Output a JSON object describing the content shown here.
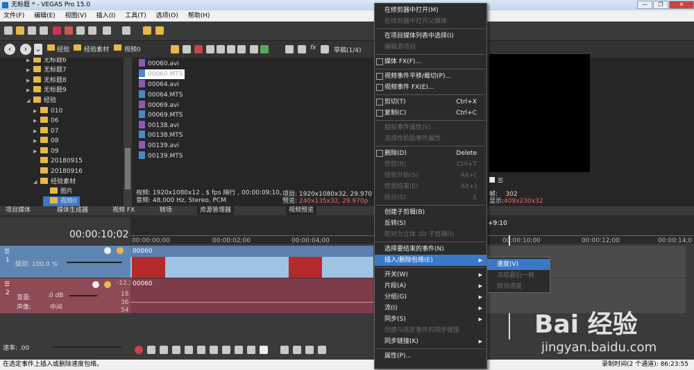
{
  "window": {
    "title": "无标题 * - VEGAS Pro 15.0"
  },
  "menubar": [
    "文件(F)",
    "编辑(E)",
    "视图(V)",
    "插入(I)",
    "工具(T)",
    "选项(O)",
    "帮助(H)"
  ],
  "explorer": {
    "breadcrumb": [
      "经验",
      "经验素材",
      "视频0"
    ],
    "tree": [
      {
        "label": "无标题6",
        "indent": 2
      },
      {
        "label": "无标题7",
        "indent": 2
      },
      {
        "label": "无标题8",
        "indent": 2
      },
      {
        "label": "无标题9",
        "indent": 2
      },
      {
        "label": "经验",
        "indent": 1
      },
      {
        "label": "010",
        "indent": 3
      },
      {
        "label": "06",
        "indent": 3
      },
      {
        "label": "07",
        "indent": 3
      },
      {
        "label": "08",
        "indent": 3
      },
      {
        "label": "09",
        "indent": 3
      },
      {
        "label": "20180915",
        "indent": 3
      },
      {
        "label": "20180916",
        "indent": 3
      },
      {
        "label": "经验素材",
        "indent": 2
      },
      {
        "label": "图片",
        "indent": 3
      },
      {
        "label": "视频0",
        "indent": 3
      }
    ],
    "files": [
      {
        "name": "00060.avi",
        "type": "avi"
      },
      {
        "name": "00060.MTS",
        "type": "mts"
      },
      {
        "name": "00064.avi",
        "type": "avi"
      },
      {
        "name": "00064.MTS",
        "type": "mts"
      },
      {
        "name": "00069.avi",
        "type": "avi"
      },
      {
        "name": "00069.MTS",
        "type": "mts"
      },
      {
        "name": "00138.avi",
        "type": "avi"
      },
      {
        "name": "00138.MTS",
        "type": "mts"
      },
      {
        "name": "00139.avi",
        "type": "avi"
      },
      {
        "name": "00139.MTS",
        "type": "mts"
      }
    ],
    "info_video": "视频: 1920x1080x12 , $ fps 隔行 , 00:00:09;10, AVC",
    "info_audio": "音频: 48,000 Hz, Stereo, PCM"
  },
  "preview": {
    "mode": "草稿(1/4)",
    "project_label": "项目: 1920x1080x32, 29.970",
    "preview_label": "预览:",
    "preview_value": "240x135x32, 29.970p",
    "frame_label": "帧:",
    "frame_value": "302",
    "display_label": "显示:",
    "display_value": "409x230x32"
  },
  "tabs": [
    "项目媒体",
    "媒体生成器",
    "视频 FX",
    "转场",
    "资源管理器",
    "视频预览"
  ],
  "timeline": {
    "timecode": "00:00:10;02",
    "ruler": [
      "00:00:00;00",
      "00:00:02;00",
      "00:00:04;00",
      "00:00:10;00",
      "00:00:12;00",
      "00:00:14;0"
    ],
    "marker_time": "+9:10",
    "video_track": {
      "level": "级别: 100.0 %",
      "clip": "00060"
    },
    "audio_track": {
      "volume_label": "音量:",
      "volume": ".0 dB",
      "pan_label": "声像:",
      "pan": "中间",
      "clip": "00060",
      "meter": "-12.3",
      "meter_ticks": [
        "18",
        "36",
        "54"
      ]
    },
    "rate": "速率: .00"
  },
  "context_menu": [
    {
      "label": "在修剪器中打开(M)",
      "enabled": true
    },
    {
      "label": "在修剪器中打开父媒体",
      "enabled": false
    },
    {
      "sep": true
    },
    {
      "label": "在项目媒体列表中选择(I)",
      "enabled": true
    },
    {
      "label": "编辑源项目",
      "enabled": false
    },
    {
      "sep": true
    },
    {
      "label": "媒体 FX(F)...",
      "enabled": true,
      "icon": "fx-icon"
    },
    {
      "sep": true
    },
    {
      "label": "视频事件平移/裁切(P)...",
      "enabled": true,
      "icon": "crop-icon"
    },
    {
      "label": "视频事件 FX(E)...",
      "enabled": true,
      "icon": "fx-icon"
    },
    {
      "sep": true
    },
    {
      "label": "剪切(T)",
      "enabled": true,
      "shortcut": "Ctrl+X",
      "icon": "scissors-icon"
    },
    {
      "label": "复制(C)",
      "enabled": true,
      "shortcut": "Ctrl+C",
      "icon": "copy-icon"
    },
    {
      "sep": true
    },
    {
      "label": "粘贴事件属性(V)",
      "enabled": false
    },
    {
      "label": "选择性粘贴事件属性",
      "enabled": false
    },
    {
      "sep": true
    },
    {
      "label": "删除(D)",
      "enabled": true,
      "shortcut": "Delete",
      "icon": "delete-icon"
    },
    {
      "label": "修剪(R)",
      "enabled": false,
      "shortcut": "Ctrl+T"
    },
    {
      "label": "修剪开始(S)",
      "enabled": false,
      "shortcut": "Alt+["
    },
    {
      "label": "修剪结束(E)",
      "enabled": false,
      "shortcut": "Alt+]"
    },
    {
      "label": "拆分(S)",
      "enabled": false,
      "shortcut": "S"
    },
    {
      "sep": true
    },
    {
      "label": "创建子剪辑(B)",
      "enabled": true
    },
    {
      "label": "反转(S)",
      "enabled": true
    },
    {
      "label": "配对为立体 3D 子剪辑(I)",
      "enabled": false
    },
    {
      "sep": true
    },
    {
      "label": "选择要结束的事件(N)",
      "enabled": true
    },
    {
      "label": "插入/删除包络(E)",
      "enabled": true,
      "submenu": true,
      "highlight": true
    },
    {
      "sep": true
    },
    {
      "label": "开关(W)",
      "enabled": true,
      "submenu": true
    },
    {
      "label": "片段(A)",
      "enabled": true,
      "submenu": true
    },
    {
      "label": "分组(G)",
      "enabled": true,
      "submenu": true
    },
    {
      "label": "流(I)",
      "enabled": true,
      "submenu": true
    },
    {
      "label": "同步(S)",
      "enabled": true,
      "submenu": true
    },
    {
      "label": "创建与选定事件的同步链接",
      "enabled": false
    },
    {
      "label": "同步链接(K)",
      "enabled": true,
      "submenu": true
    },
    {
      "sep": true
    },
    {
      "label": "属性(P)...",
      "enabled": true
    }
  ],
  "submenu": [
    {
      "label": "速度(V)",
      "enabled": true,
      "highlight": true
    },
    {
      "label": "冻结最后一帧",
      "enabled": false
    },
    {
      "label": "转场速度",
      "enabled": false
    }
  ],
  "watermark": {
    "brand": "Bai 经验",
    "url": "jingyan.baidu.com"
  },
  "statusbar": {
    "left": "在选定事件上插入或删除速度包络。",
    "right": "录制时间(2 个通道): 86:23:55"
  }
}
